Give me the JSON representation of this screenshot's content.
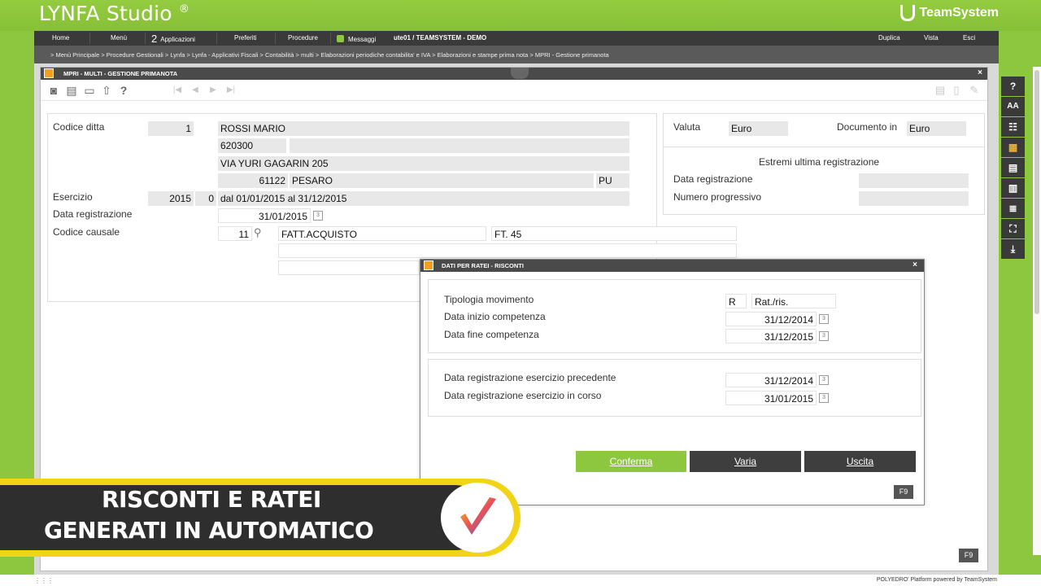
{
  "brand": {
    "app_title": "LYNFA Studio",
    "reg_mark": "®",
    "company": "TeamSystem",
    "accent": "#8dc63f"
  },
  "nav": {
    "home": "Home",
    "menu": "Menù",
    "apps_count": "2",
    "apps": "Applicazioni",
    "favorites": "Preferiti",
    "procedures": "Procedure",
    "messages": "Messaggi",
    "user": "ute01 / TEAMSYSTEM - DEMO",
    "duplicate": "Duplica",
    "view": "Vista",
    "exit": "Esci"
  },
  "breadcrumb": "> Menù Principale > Procedure Gestionali > Lynfa > Lynfa - Applicativi Fiscali > Contabilità > multi > Elaborazioni periodiche contabilita' e IVA > Elaborazioni e stampe prima nota > MPRI - Gestione primanota",
  "window": {
    "title": "MPRI - MULTI - GESTIONE PRIMANOTA"
  },
  "form": {
    "codice_ditta_label": "Codice ditta",
    "codice_ditta": "1",
    "ragione_sociale": "ROSSI MARIO",
    "codice_2": "620300",
    "indirizzo": "VIA YURI GAGARIN 205",
    "cap": "61122",
    "citta": "PESARO",
    "provincia": "PU",
    "esercizio_label": "Esercizio",
    "esercizio": "2015",
    "esercizio_num": "0",
    "periodo": "dal 01/01/2015 al 31/12/2015",
    "data_reg_label": "Data registrazione",
    "data_reg": "31/01/2015",
    "causale_label": "Codice causale",
    "causale_code": "11",
    "causale_desc": "FATT.ACQUISTO",
    "causale_extra": "FT. 45"
  },
  "right_panel": {
    "valuta_label": "Valuta",
    "valuta": "Euro",
    "documento_label": "Documento in",
    "documento": "Euro",
    "estremi_title": "Estremi ultima registrazione",
    "data_reg_label": "Data registrazione",
    "num_prog_label": "Numero progressivo"
  },
  "sidebar": {
    "help": "?",
    "font": "AA"
  },
  "dialog": {
    "title": "DATI PER RATEI - RISCONTI",
    "tipologia_label": "Tipologia movimento",
    "tipologia_code": "R",
    "tipologia_desc": "Rat./ris.",
    "inizio_label": "Data inizio competenza",
    "inizio": "31/12/2014",
    "fine_label": "Data fine competenza",
    "fine": "31/12/2015",
    "prec_label": "Data registrazione esercizio precedente",
    "prec": "31/12/2014",
    "corso_label": "Data registrazione esercizio in corso",
    "corso": "31/01/2015",
    "confirm": "Conferma",
    "vary": "Varia",
    "exit": "Uscita",
    "f9": "F9"
  },
  "main_f9": "F9",
  "promo": {
    "line1": "RISCONTI E RATEI",
    "line2": "GENERATI IN AUTOMATICO"
  },
  "footer": {
    "powered": "POLYEDRO' Platform powered by  TeamSystem"
  }
}
